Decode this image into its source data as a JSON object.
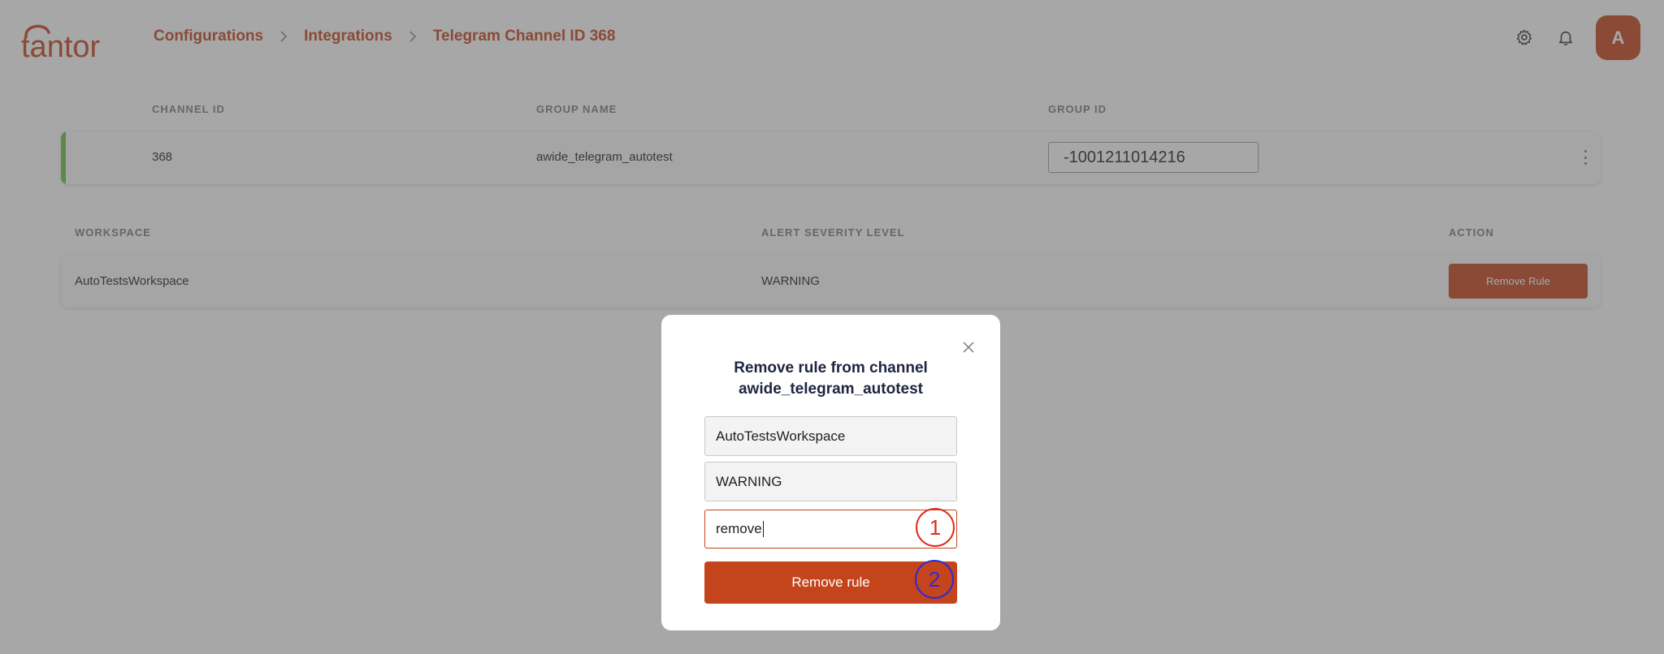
{
  "header": {
    "logo_text": "tantor",
    "breadcrumb": [
      "Configurations",
      "Integrations",
      "Telegram Channel ID 368"
    ],
    "avatar_letter": "A"
  },
  "channel_table": {
    "columns": [
      "CHANNEL ID",
      "GROUP NAME",
      "GROUP ID"
    ],
    "row": {
      "channel_id": "368",
      "group_name": "awide_telegram_autotest",
      "group_id": "-1001211014216"
    },
    "status_color": "#6dbf4b"
  },
  "rules_table": {
    "columns": [
      "WORKSPACE",
      "ALERT SEVERITY LEVEL",
      "ACTION"
    ],
    "row": {
      "workspace": "AutoTestsWorkspace",
      "severity": "WARNING",
      "action_label": "Remove Rule"
    }
  },
  "modal": {
    "title_line1": "Remove rule from channel",
    "title_line2": "awide_telegram_autotest",
    "workspace_value": "AutoTestsWorkspace",
    "severity_value": "WARNING",
    "confirm_input_value": "remove",
    "submit_label": "Remove rule"
  },
  "annotations": [
    "1",
    "2"
  ],
  "colors": {
    "accent": "#c4451c",
    "annotation_1": "#e02b1e",
    "annotation_2": "#2b2bd8"
  }
}
